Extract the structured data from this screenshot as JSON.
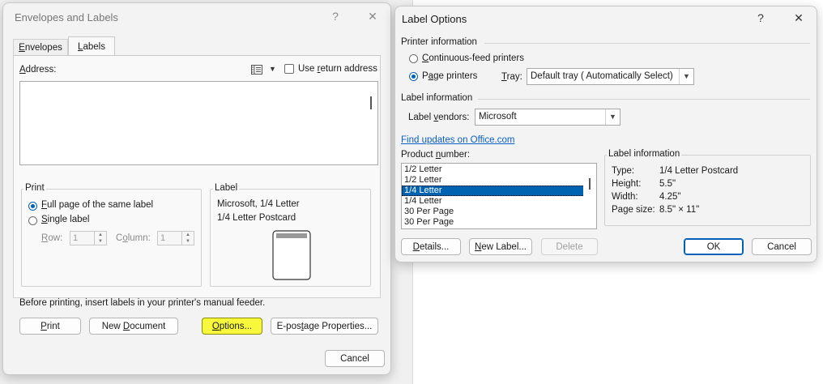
{
  "env": {
    "title": "Envelopes and Labels",
    "help": "?",
    "close": "✕",
    "tabs": [
      {
        "pre": "",
        "u": "E",
        "post": "nvelopes"
      },
      {
        "pre": "",
        "u": "L",
        "post": "abels"
      }
    ],
    "address_label": {
      "pre": "",
      "u": "A",
      "post": "ddress:"
    },
    "use_return": {
      "pre": "Use ",
      "u": "r",
      "post": "eturn address"
    },
    "print_group": "Print",
    "full_page": {
      "pre": "",
      "u": "F",
      "post": "ull page of the same label"
    },
    "single_label": {
      "pre": "",
      "u": "S",
      "post": "ingle label"
    },
    "row_label": {
      "pre": "",
      "u": "R",
      "post": "ow:"
    },
    "row_value": "1",
    "column_label": {
      "pre": "C",
      "u": "o",
      "post": "lumn:"
    },
    "column_value": "1",
    "label_group": "Label",
    "label_line1": "Microsoft, 1/4 Letter",
    "label_line2": "1/4 Letter Postcard",
    "notice": "Before printing, insert labels in your printer's manual feeder.",
    "print_btn": {
      "pre": "",
      "u": "P",
      "post": "rint"
    },
    "new_doc_btn": {
      "pre": "New ",
      "u": "D",
      "post": "ocument"
    },
    "options_btn": {
      "pre": "",
      "u": "O",
      "post": "ptions..."
    },
    "epostage_btn": {
      "pre": "E-pos",
      "u": "t",
      "post": "age Properties..."
    },
    "cancel_btn": "Cancel"
  },
  "lo": {
    "title": "Label Options",
    "help": "?",
    "close": "✕",
    "printer_info": "Printer information",
    "continuous": {
      "pre": "",
      "u": "C",
      "post": "ontinuous-feed printers"
    },
    "page_printers": {
      "pre": "P",
      "u": "a",
      "post": "ge printers"
    },
    "tray_label": {
      "pre": "",
      "u": "T",
      "post": "ray:"
    },
    "tray_value": "Default tray ( Automatically Select)",
    "label_info": "Label information",
    "vendors_label": {
      "pre": "Label ",
      "u": "v",
      "post": "endors:"
    },
    "vendors_value": "Microsoft",
    "find_updates": "Find updates on Office.com",
    "product_number": {
      "pre": "Product ",
      "u": "n",
      "post": "umber:"
    },
    "products": [
      "1/2 Letter",
      "1/2 Letter",
      "1/4 Letter",
      "1/4 Letter",
      "30 Per Page",
      "30 Per Page"
    ],
    "selected_index": 2,
    "info_title": "Label information",
    "type_label": "Type:",
    "type_value": "1/4 Letter Postcard",
    "height_label": "Height:",
    "height_value": "5.5\"",
    "width_label": "Width:",
    "width_value": "4.25\"",
    "pagesize_label": "Page size:",
    "pagesize_value": "8.5\" × 11\"",
    "details_btn": {
      "pre": "",
      "u": "D",
      "post": "etails..."
    },
    "newlabel_btn": {
      "pre": "",
      "u": "N",
      "post": "ew Label..."
    },
    "delete_btn": "Delete",
    "ok_btn": "OK",
    "cancel_btn": "Cancel"
  },
  "colors": {
    "accent": "#005fb8",
    "highlight": "#f7f73c",
    "link": "#0a5fc2",
    "selection": "#0063b1"
  },
  "icons": [
    "help-icon",
    "close-icon",
    "address-book-icon",
    "dropdown-arrow-icon",
    "label-preview-icon",
    "spinner-icon"
  ]
}
